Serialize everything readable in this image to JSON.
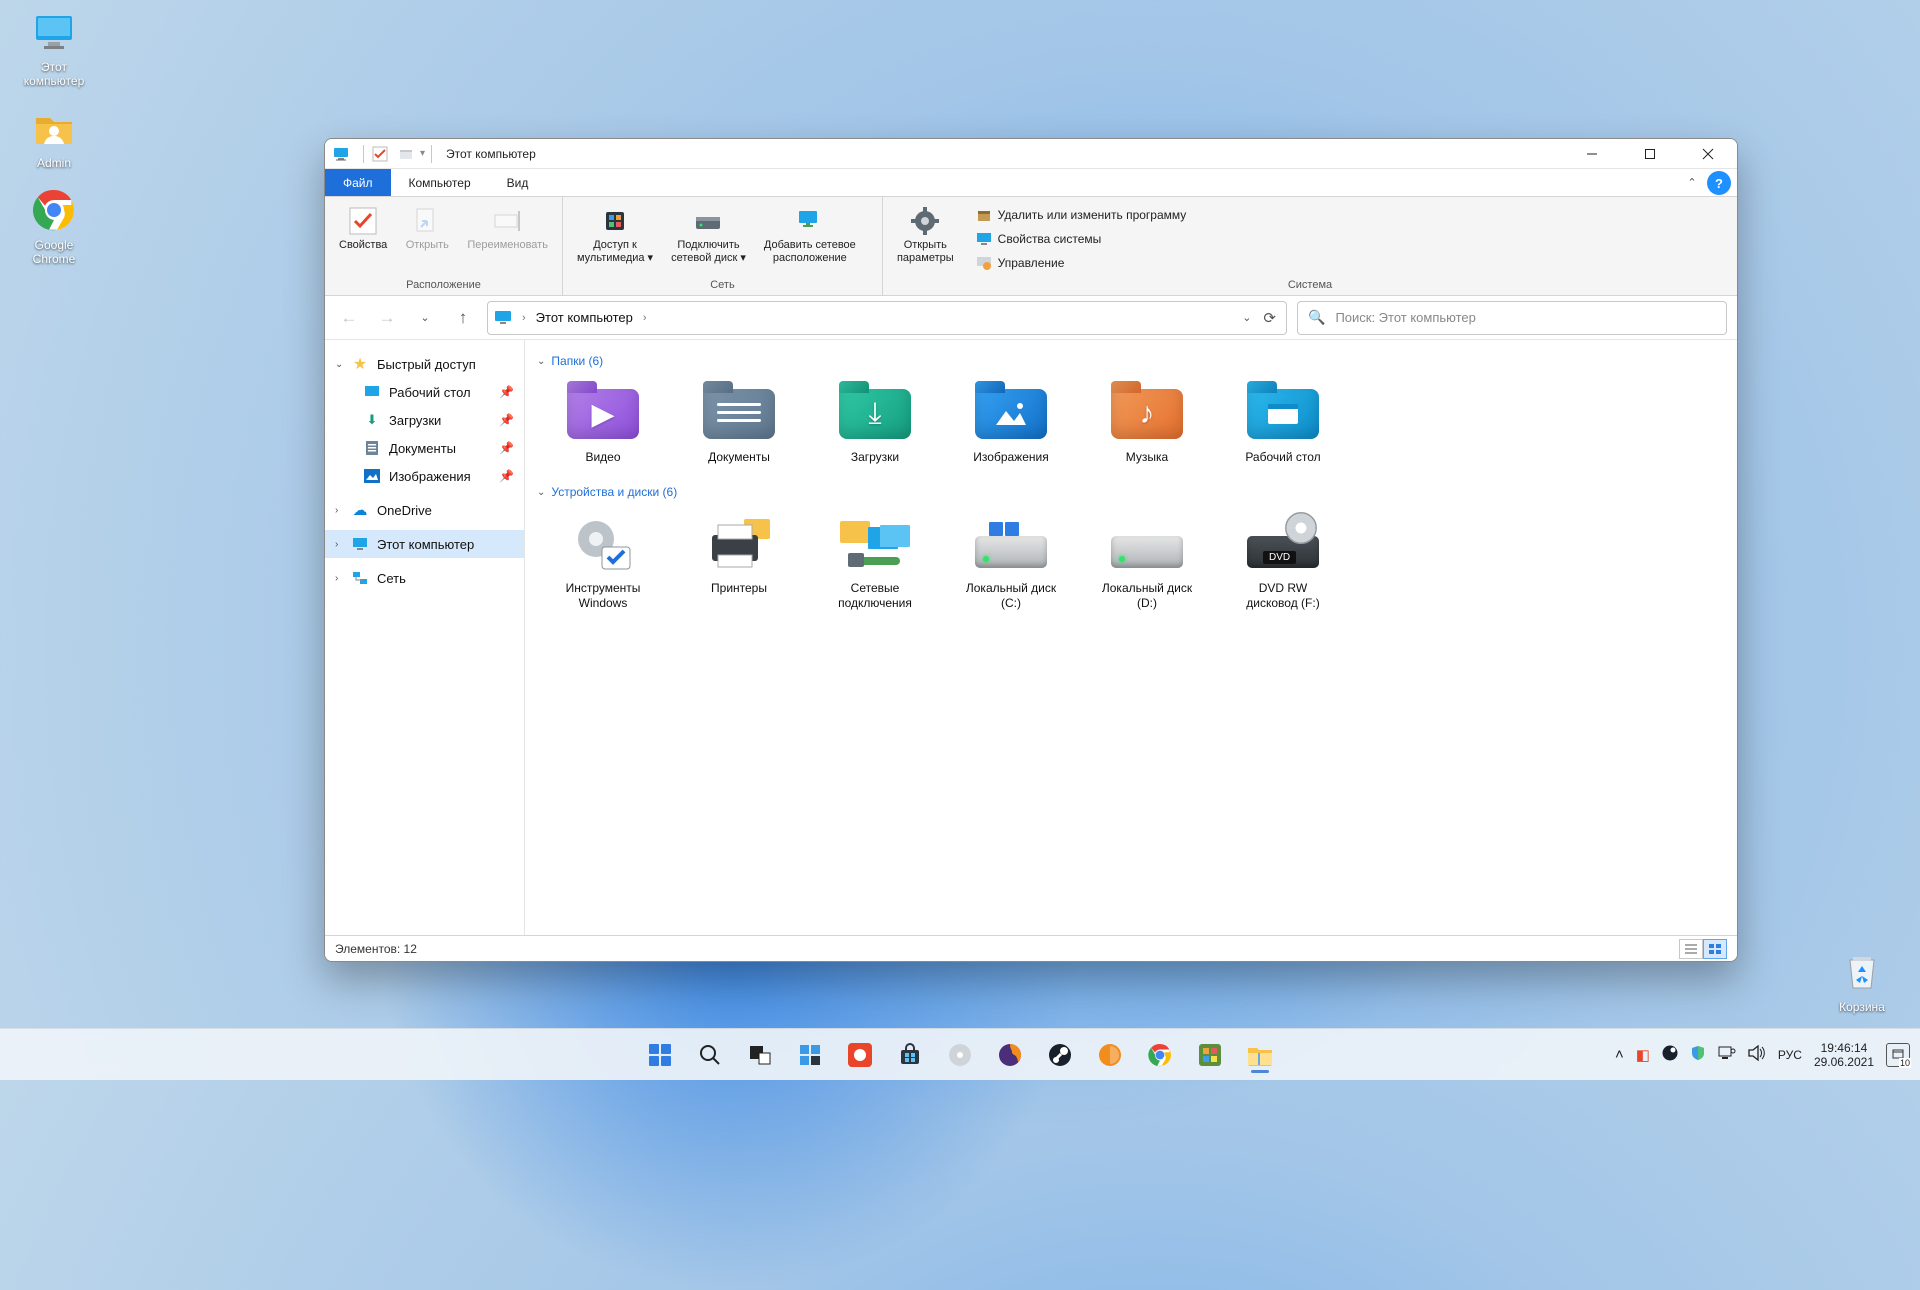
{
  "desktop": {
    "icons": [
      {
        "name": "this-pc",
        "label": "Этот\nкомпьютер"
      },
      {
        "name": "admin",
        "label": "Admin"
      },
      {
        "name": "chrome",
        "label": "Google\nChrome"
      }
    ],
    "recycle": "Корзина"
  },
  "window": {
    "title": "Этот компьютер",
    "tabs": {
      "file": "Файл",
      "computer": "Компьютер",
      "view": "Вид"
    },
    "ribbon": {
      "group_location": "Расположение",
      "group_network": "Сеть",
      "group_system": "Система",
      "props": "Свойства",
      "open": "Открыть",
      "rename": "Переименовать",
      "media": "Доступ к\nмультимедиа ▾",
      "netdrive": "Подключить\nсетевой диск ▾",
      "addnet": "Добавить сетевое\nрасположение",
      "openparams": "Открыть\nпараметры",
      "uninstall": "Удалить или изменить программу",
      "sysprops": "Свойства системы",
      "manage": "Управление"
    },
    "path": {
      "root": "Этот компьютер"
    },
    "search_ph": "Поиск: Этот компьютер",
    "side": {
      "quick": "Быстрый доступ",
      "desktop": "Рабочий стол",
      "downloads": "Загрузки",
      "documents": "Документы",
      "pictures": "Изображения",
      "onedrive": "OneDrive",
      "thispc": "Этот компьютер",
      "network": "Сеть"
    },
    "sections": {
      "folders": "Папки (6)",
      "drives": "Устройства и диски (6)"
    },
    "folders": [
      {
        "k": "video",
        "label": "Видео"
      },
      {
        "k": "docs",
        "label": "Документы"
      },
      {
        "k": "downloads",
        "label": "Загрузки"
      },
      {
        "k": "pictures",
        "label": "Изображения"
      },
      {
        "k": "music",
        "label": "Музыка"
      },
      {
        "k": "desk",
        "label": "Рабочий стол"
      }
    ],
    "drives": [
      {
        "k": "wintools",
        "label": "Инструменты\nWindows"
      },
      {
        "k": "printers",
        "label": "Принтеры"
      },
      {
        "k": "netconn",
        "label": "Сетевые\nподключения"
      },
      {
        "k": "c",
        "label": "Локальный диск\n(C:)"
      },
      {
        "k": "d",
        "label": "Локальный диск\n(D:)"
      },
      {
        "k": "dvd",
        "label": "DVD RW\nдисковод (F:)"
      }
    ],
    "status": "Элементов: 12"
  },
  "taskbar": {
    "lang": "РУС",
    "time": "19:46:14",
    "date": "29.06.2021",
    "notif_count": "10"
  }
}
